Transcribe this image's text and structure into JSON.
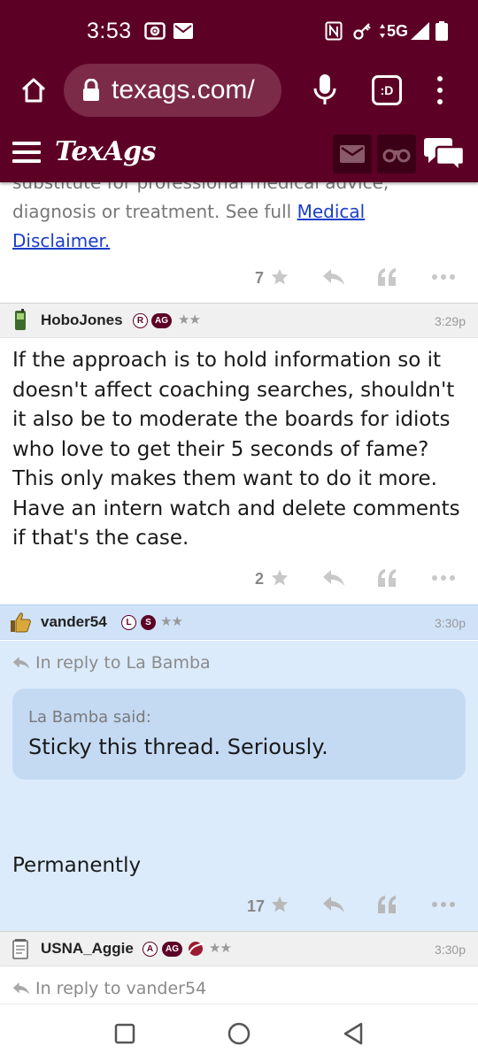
{
  "status_bar": {
    "time": "3:53",
    "network": "5G"
  },
  "browser": {
    "url": "texags.com/",
    "tabs_label": ":D"
  },
  "site": {
    "logo": "TexAgs"
  },
  "previous_post": {
    "disclaimer_prefix": "substitute for professional medical advice, diagnosis or treatment. See full ",
    "disclaimer_link": "Medical Disclaimer.",
    "star_count": "7"
  },
  "posts": [
    {
      "username": "HoboJones",
      "badges": [
        "R",
        "AG"
      ],
      "stars": "★★",
      "time": "3:29p",
      "body": "If the approach is to hold information so it doesn't affect coaching searches, shouldn't it also be to moderate the boards for idiots who love to get their 5 seconds of fame? This only makes them want to do it more. Have an intern watch and delete comments if that's the case.",
      "star_count": "2"
    },
    {
      "username": "vander54",
      "badges": [
        "L",
        "S"
      ],
      "stars": "★★",
      "time": "3:30p",
      "reply_to": "In reply to La Bamba",
      "quote_author": "La Bamba said:",
      "quote_text": "Sticky this thread. Seriously.",
      "body": "Permanently",
      "star_count": "17"
    },
    {
      "username": "USNA_Aggie",
      "badges": [
        "A",
        "AG"
      ],
      "stars": "★★",
      "time": "3:30p",
      "reply_to": "In reply to vander54"
    }
  ],
  "colors": {
    "maroon": "#5d0025",
    "reply_bg": "#dcebfb",
    "quote_bg": "#c4daf3",
    "link": "#1a3ec9"
  }
}
